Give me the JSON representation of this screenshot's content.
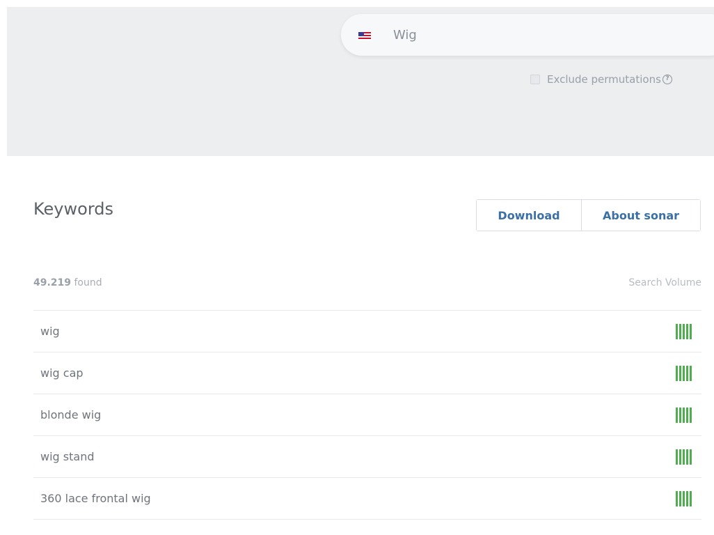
{
  "search": {
    "value": "Wig",
    "flag_icon": "us-flag-icon",
    "exclude_label": "Exclude permutations",
    "help_icon": "help-icon"
  },
  "keywords": {
    "title": "Keywords",
    "download_label": "Download",
    "about_label": "About sonar",
    "found_count": "49.219",
    "found_suffix": "found",
    "volume_header": "Search Volume",
    "volume_color": "#4cae4c",
    "rows": [
      {
        "keyword": "wig",
        "volume_level": 5
      },
      {
        "keyword": "wig cap",
        "volume_level": 5
      },
      {
        "keyword": "blonde wig",
        "volume_level": 5
      },
      {
        "keyword": "wig stand",
        "volume_level": 5
      },
      {
        "keyword": "360 lace frontal wig",
        "volume_level": 5
      }
    ]
  }
}
